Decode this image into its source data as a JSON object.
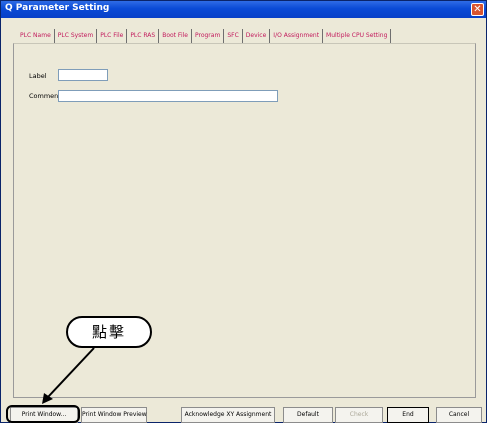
{
  "window": {
    "title": "Q Parameter Setting",
    "close_glyph": "✕"
  },
  "tabs": [
    {
      "label": "PLC Name"
    },
    {
      "label": "PLC System"
    },
    {
      "label": "PLC File"
    },
    {
      "label": "PLC RAS"
    },
    {
      "label": "Boot File"
    },
    {
      "label": "Program"
    },
    {
      "label": "SFC"
    },
    {
      "label": "Device"
    },
    {
      "label": "I/O Assignment"
    },
    {
      "label": "Multiple CPU Setting"
    }
  ],
  "form": {
    "label_caption": "Label",
    "label_value": "",
    "comment_caption": "Comment",
    "comment_value": ""
  },
  "buttons": {
    "print_window": "Print Window...",
    "print_preview": "Print Window Preview",
    "acknowledge": "Acknowledge XY Assignment",
    "default": "Default",
    "check": "Check",
    "end": "End",
    "cancel": "Cancel"
  },
  "annotation": {
    "callout_text": "點擊"
  },
  "colors": {
    "tab_text": "#c2185b",
    "titlebar": "#0a4ad6",
    "window_bg": "#ece9d8"
  },
  "icons": {
    "close": "close-icon"
  }
}
